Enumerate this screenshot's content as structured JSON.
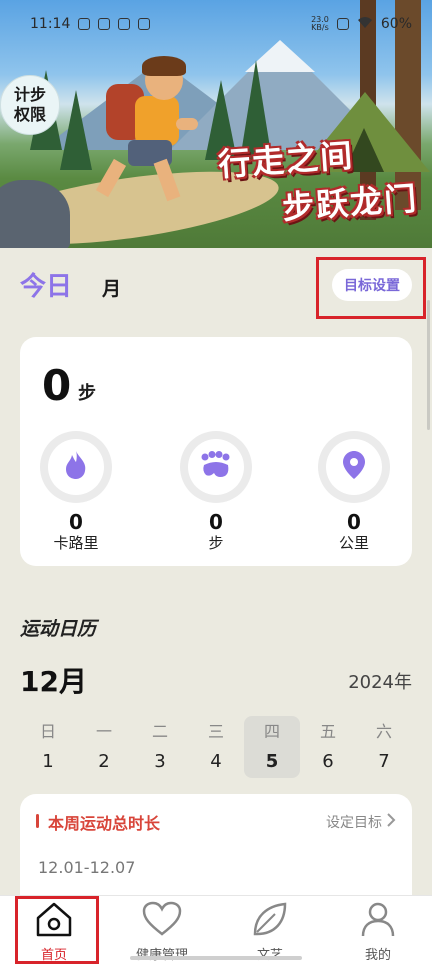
{
  "status_bar": {
    "time": "11:14",
    "net_speed": "23.0\nKB/s",
    "battery": "60%"
  },
  "hero": {
    "badge_line1": "计步",
    "badge_line2": "权限",
    "slogan_line1": "行走之间",
    "slogan_line2": "步跃龙门"
  },
  "tabs": {
    "today": "今日",
    "month": "月"
  },
  "goal_setting_label": "目标设置",
  "steps": {
    "value": "0",
    "unit": "步"
  },
  "stats": [
    {
      "value": "0",
      "label": "卡路里",
      "icon": "flame-icon"
    },
    {
      "value": "0",
      "label": "步",
      "icon": "footprint-icon"
    },
    {
      "value": "0",
      "label": "公里",
      "icon": "location-pin-icon"
    }
  ],
  "calendar": {
    "title": "运动日历",
    "month": "12月",
    "year": "2024年",
    "weekdays": [
      "日",
      "一",
      "二",
      "三",
      "四",
      "五",
      "六"
    ],
    "dates": [
      "1",
      "2",
      "3",
      "4",
      "5",
      "6",
      "7"
    ],
    "selected_index": 4
  },
  "weekly_card": {
    "title": "本周运动总时长",
    "set_goal": "设定目标",
    "range": "12.01-12.07"
  },
  "nav": [
    {
      "label": "首页",
      "icon": "home-icon",
      "active": true
    },
    {
      "label": "健康管理",
      "icon": "heart-icon",
      "active": false
    },
    {
      "label": "文艺",
      "icon": "leaf-icon",
      "active": false
    },
    {
      "label": "我的",
      "icon": "person-icon",
      "active": false
    }
  ],
  "colors": {
    "accent": "#8d74e8",
    "highlight_red": "#d8232a",
    "card_red": "#d8453a"
  }
}
